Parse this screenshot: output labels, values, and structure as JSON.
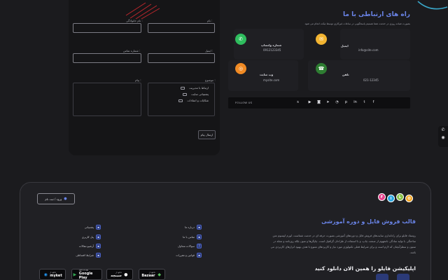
{
  "form": {
    "labels": {
      "name": "نام :",
      "family": "نام خانوادگی :",
      "email": "ایمیل :",
      "phone": "شماره تماس :",
      "subject": "موضوع :",
      "message": "پیام :"
    },
    "subjects": [
      "ارتباط با مدیریت",
      "پشتیبانی سایت",
      "شکایات و انتقادات"
    ],
    "send": "ارسال پیام"
  },
  "contact": {
    "title": "راه های ارتباطی با ما",
    "subtitle": "بصورت شبانه روزی در خدمت شما هستیم پاسخگویی در ساعات غیرکاری توسط تیکت انجام می شود",
    "cards": [
      {
        "title": "ایمیل",
        "value": "info@site.com",
        "icon": "mail-icon",
        "color": "#f2b431"
      },
      {
        "title": "شماره واتساپ",
        "value": "0912123345",
        "icon": "whatsapp-icon",
        "color": "#2fbd5e"
      },
      {
        "title": "تلفن",
        "value": "021-12345",
        "icon": "phone-icon",
        "color": "#2e7d32"
      },
      {
        "title": "وب سایت",
        "value": "mysite.com",
        "icon": "globe-icon",
        "color": "#f08a24"
      }
    ],
    "follow_label": "FOLLOW US",
    "socials": [
      "facebook-icon",
      "twitter-icon",
      "linkedin-icon",
      "pinterest-icon",
      "rss-icon",
      "telegram-icon",
      "instagram-icon",
      "youtube-icon",
      "skype-icon"
    ]
  },
  "footer": {
    "login": "ورود / ثبت نام",
    "logo_letters": [
      "F",
      "I",
      "L",
      "O"
    ],
    "shop_title": "قالب فروش فایل و دوره آموزشی",
    "shop_desc": "روستاد فایلو برای راه‌اندازی سایت‌های فروش فایل و دوره‌های آموزشی بصورت حرفه ای در خدمت شماست. لورم ایپسوم متن ساختگی با تولید سادگی نامفهوم از صنعت چاپ، و با استفاده از طراحان گرافیک است. چاپگرها و متون بلکه روزنامه و مجله در ستون و سطرآنچنان که لازم است و برای شرایط فعلی تکنولوژی مورد نیاز و کاربردهای متنوع با هدف بهبود ابزارهای کاربردی می باشد.",
    "links_right": [
      "درباره ما",
      "تماس با ما",
      "سوالات متداول",
      "قوانین و مقررات"
    ],
    "links_left": [
      "پشتیبانی",
      "پنل کاربری",
      "آرشیو مقالات",
      "شرایط اقساطی"
    ],
    "app_title": "اپلیکیشن فایلو را همین الان دانلود کنید",
    "stores": [
      {
        "sub": "دانلود از",
        "name": "Bazaar",
        "icon": "bazaar-icon"
      },
      {
        "sub": "دانلود از",
        "name": "سیبچه",
        "icon": "sibche-icon"
      },
      {
        "sub": "GET IT ON",
        "name": "Google Play",
        "icon": "google-play-icon"
      },
      {
        "sub": "دانلود از",
        "name": "myket",
        "icon": "myket-icon"
      }
    ]
  },
  "colors": {
    "accent": "#6a84e8",
    "panel": "#151517",
    "footer": "#202024"
  }
}
